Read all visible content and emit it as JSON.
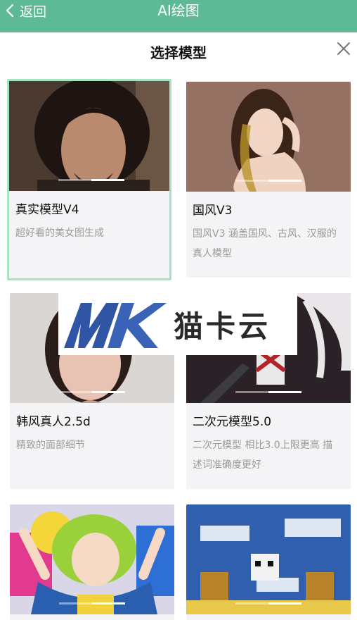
{
  "header": {
    "back_label": "返回",
    "title": "AI绘图"
  },
  "sheet": {
    "title": "选择模型"
  },
  "models": [
    {
      "title": "真实模型V4",
      "desc": "超好看的美女图生成",
      "selected": true
    },
    {
      "title": "国风V3",
      "desc": "国风V3 涵盖国风、古风、汉服的真人模型",
      "selected": false
    },
    {
      "title": "韩风真人2.5d",
      "desc": "精致的面部细节",
      "selected": false
    },
    {
      "title": "二次元模型5.0",
      "desc": "二次元模型 相比3.0上限更高 描述词准确度更好",
      "selected": false
    }
  ],
  "watermark": {
    "logo_text": "MK",
    "text": "猫卡云"
  },
  "colors": {
    "header_bg": "#5db996",
    "selected_border": "#a6e4c1",
    "card_bg": "#f4f4f6"
  }
}
